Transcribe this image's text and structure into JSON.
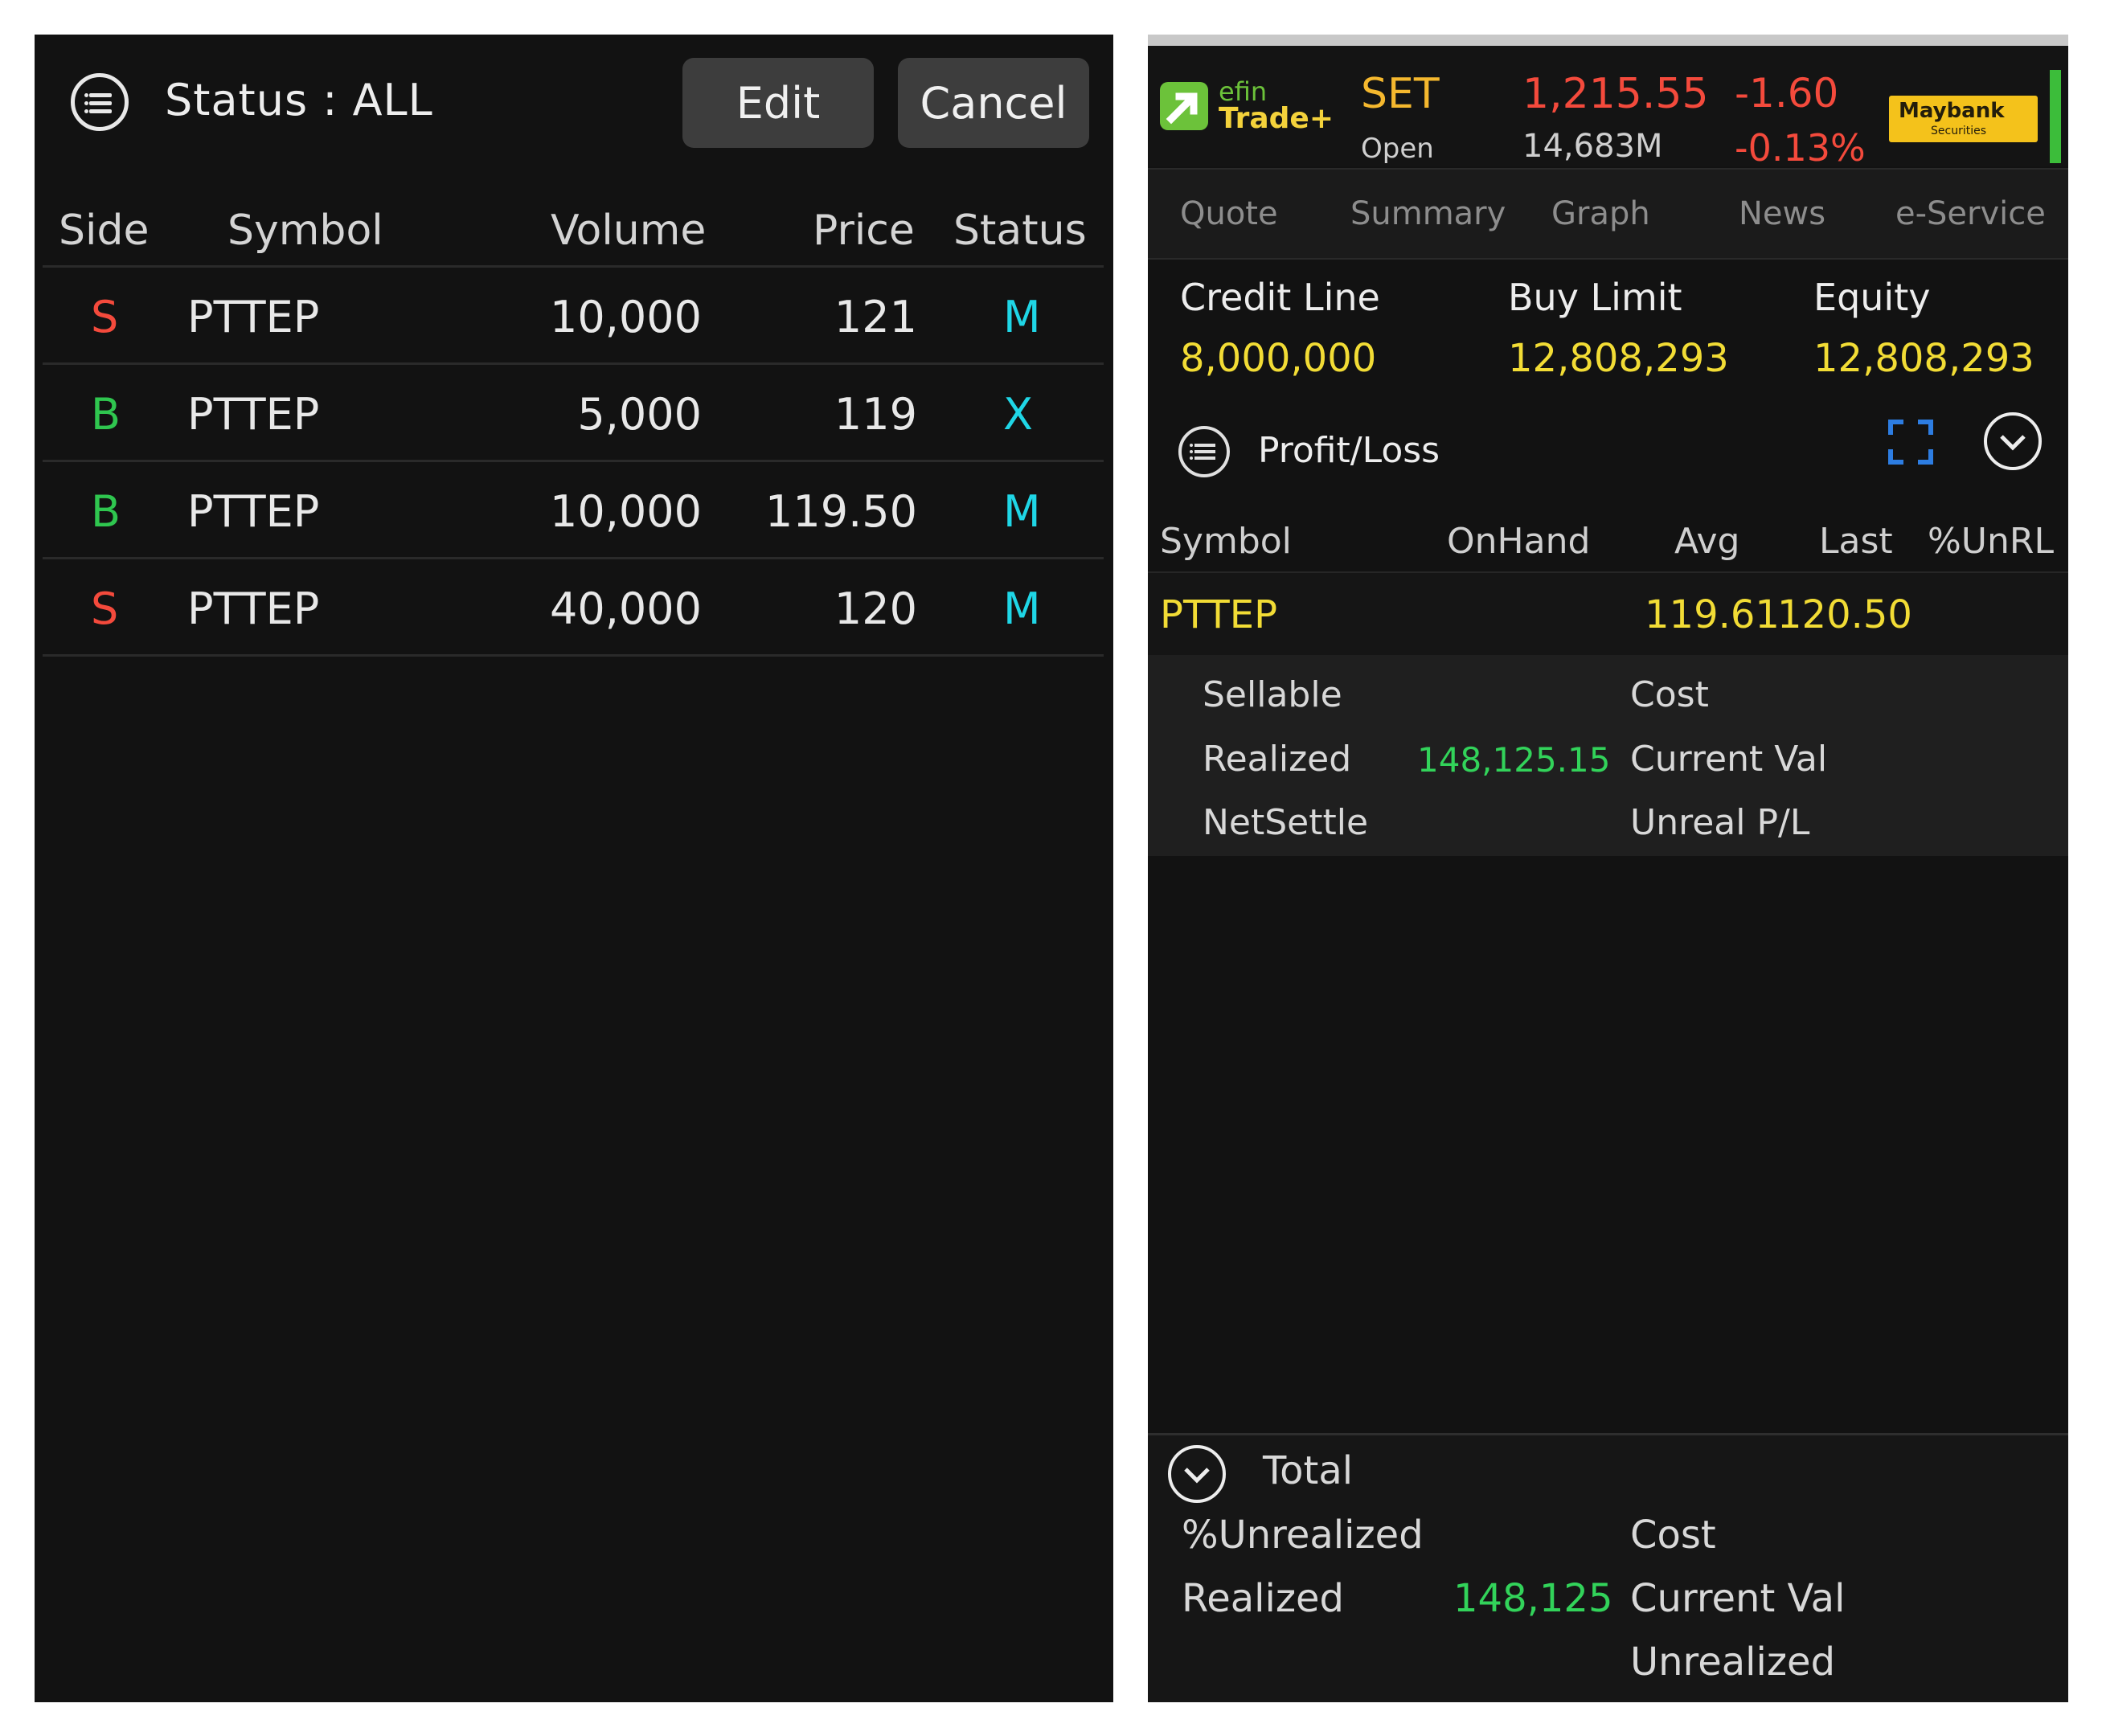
{
  "left": {
    "status_label": "Status : ALL",
    "edit_label": "Edit",
    "cancel_label": "Cancel",
    "columns": [
      "Side",
      "Symbol",
      "Volume",
      "Price",
      "Status"
    ],
    "orders": [
      {
        "side": "S",
        "symbol": "PTTEP",
        "volume": "10,000",
        "price": "121",
        "status": "M"
      },
      {
        "side": "B",
        "symbol": "PTTEP",
        "volume": "5,000",
        "price": "119",
        "status": "X"
      },
      {
        "side": "B",
        "symbol": "PTTEP",
        "volume": "10,000",
        "price": "119.50",
        "status": "M"
      },
      {
        "side": "S",
        "symbol": "PTTEP",
        "volume": "40,000",
        "price": "120",
        "status": "M"
      }
    ]
  },
  "right": {
    "logo": {
      "efin": "efin",
      "trade": "Trade+"
    },
    "market": {
      "name": "SET",
      "state": "Open",
      "index": "1,215.55",
      "volume": "14,683M",
      "change": "-1.60",
      "change_pct": "-0.13%"
    },
    "broker": {
      "name": "Maybank",
      "sub": "Securities"
    },
    "tabs": [
      "Quote",
      "Summary",
      "Graph",
      "News",
      "e-Service"
    ],
    "account": {
      "credit_line_label": "Credit Line",
      "credit_line": "8,000,000",
      "buy_limit_label": "Buy Limit",
      "buy_limit": "12,808,293",
      "equity_label": "Equity",
      "equity": "12,808,293"
    },
    "profit_loss": {
      "title": "Profit/Loss",
      "columns": [
        "Symbol",
        "OnHand",
        "Avg",
        "Last",
        "%UnRL"
      ],
      "row": {
        "symbol": "PTTEP",
        "onhand": "",
        "avg": "119.61",
        "last": "120.50",
        "unrl": ""
      },
      "detail": {
        "sellable_label": "Sellable",
        "cost_label": "Cost",
        "realized_label": "Realized",
        "realized_value": "148,125.15",
        "current_val_label": "Current Val",
        "netsettle_label": "NetSettle",
        "unreal_pl_label": "Unreal P/L"
      }
    },
    "total": {
      "title": "Total",
      "unrealized_pct_label": "%Unrealized",
      "cost_label": "Cost",
      "realized_label": "Realized",
      "realized_value": "148,125",
      "current_val_label": "Current Val",
      "unrealized_label": "Unrealized"
    }
  },
  "colors": {
    "sell": "#f44a3c",
    "buy": "#2fc64f",
    "status": "#1fd6e6",
    "value_yellow": "#f2dc35",
    "value_green": "#32d35a",
    "accent_blue": "#2d7de2"
  }
}
